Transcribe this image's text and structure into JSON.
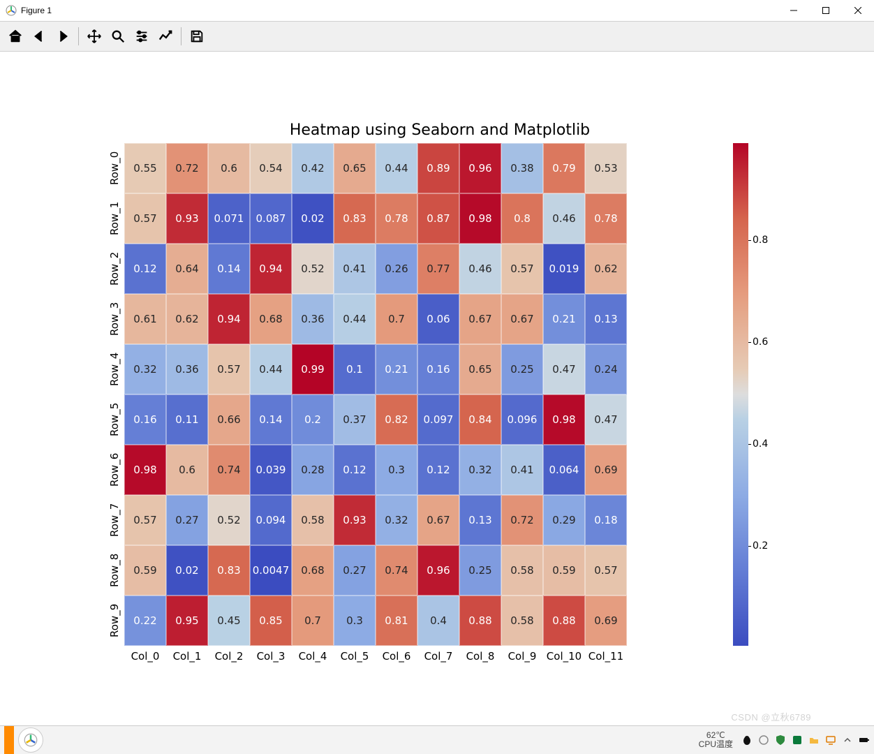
{
  "window": {
    "title": "Figure 1"
  },
  "toolbar": {
    "home": "Home",
    "back": "Back",
    "forward": "Forward",
    "pan": "Pan",
    "zoom": "Zoom",
    "configure": "Configure subplots",
    "edit": "Edit axis",
    "save": "Save"
  },
  "taskbar": {
    "temp_value": "62℃",
    "temp_label": "CPU温度",
    "watermark": "CSDN @立秋6789"
  },
  "chart_data": {
    "type": "heatmap",
    "title": "Heatmap using Seaborn and Matplotlib",
    "xlabel": "",
    "ylabel": "",
    "x_categories": [
      "Col_0",
      "Col_1",
      "Col_2",
      "Col_3",
      "Col_4",
      "Col_5",
      "Col_6",
      "Col_7",
      "Col_8",
      "Col_9",
      "Col_10",
      "Col_11"
    ],
    "y_categories": [
      "Row_0",
      "Row_1",
      "Row_2",
      "Row_3",
      "Row_4",
      "Row_5",
      "Row_6",
      "Row_7",
      "Row_8",
      "Row_9"
    ],
    "values": [
      [
        0.55,
        0.72,
        0.6,
        0.54,
        0.42,
        0.65,
        0.44,
        0.89,
        0.96,
        0.38,
        0.79,
        0.53
      ],
      [
        0.57,
        0.93,
        0.071,
        0.087,
        0.02,
        0.83,
        0.78,
        0.87,
        0.98,
        0.8,
        0.46,
        0.78
      ],
      [
        0.12,
        0.64,
        0.14,
        0.94,
        0.52,
        0.41,
        0.26,
        0.77,
        0.46,
        0.57,
        0.019,
        0.62
      ],
      [
        0.61,
        0.62,
        0.94,
        0.68,
        0.36,
        0.44,
        0.7,
        0.06,
        0.67,
        0.67,
        0.21,
        0.13
      ],
      [
        0.32,
        0.36,
        0.57,
        0.44,
        0.99,
        0.1,
        0.21,
        0.16,
        0.65,
        0.25,
        0.47,
        0.24
      ],
      [
        0.16,
        0.11,
        0.66,
        0.14,
        0.2,
        0.37,
        0.82,
        0.097,
        0.84,
        0.096,
        0.98,
        0.47
      ],
      [
        0.98,
        0.6,
        0.74,
        0.039,
        0.28,
        0.12,
        0.3,
        0.12,
        0.32,
        0.41,
        0.064,
        0.69
      ],
      [
        0.57,
        0.27,
        0.52,
        0.094,
        0.58,
        0.93,
        0.32,
        0.67,
        0.13,
        0.72,
        0.29,
        0.18
      ],
      [
        0.59,
        0.02,
        0.83,
        0.0047,
        0.68,
        0.27,
        0.74,
        0.96,
        0.25,
        0.58,
        0.59,
        0.57
      ],
      [
        0.22,
        0.95,
        0.45,
        0.85,
        0.7,
        0.3,
        0.81,
        0.4,
        0.88,
        0.58,
        0.88,
        0.69
      ]
    ],
    "value_labels": [
      [
        "0.55",
        "0.72",
        "0.6",
        "0.54",
        "0.42",
        "0.65",
        "0.44",
        "0.89",
        "0.96",
        "0.38",
        "0.79",
        "0.53"
      ],
      [
        "0.57",
        "0.93",
        "0.071",
        "0.087",
        "0.02",
        "0.83",
        "0.78",
        "0.87",
        "0.98",
        "0.8",
        "0.46",
        "0.78"
      ],
      [
        "0.12",
        "0.64",
        "0.14",
        "0.94",
        "0.52",
        "0.41",
        "0.26",
        "0.77",
        "0.46",
        "0.57",
        "0.019",
        "0.62"
      ],
      [
        "0.61",
        "0.62",
        "0.94",
        "0.68",
        "0.36",
        "0.44",
        "0.7",
        "0.06",
        "0.67",
        "0.67",
        "0.21",
        "0.13"
      ],
      [
        "0.32",
        "0.36",
        "0.57",
        "0.44",
        "0.99",
        "0.1",
        "0.21",
        "0.16",
        "0.65",
        "0.25",
        "0.47",
        "0.24"
      ],
      [
        "0.16",
        "0.11",
        "0.66",
        "0.14",
        "0.2",
        "0.37",
        "0.82",
        "0.097",
        "0.84",
        "0.096",
        "0.98",
        "0.47"
      ],
      [
        "0.98",
        "0.6",
        "0.74",
        "0.039",
        "0.28",
        "0.12",
        "0.3",
        "0.12",
        "0.32",
        "0.41",
        "0.064",
        "0.69"
      ],
      [
        "0.57",
        "0.27",
        "0.52",
        "0.094",
        "0.58",
        "0.93",
        "0.32",
        "0.67",
        "0.13",
        "0.72",
        "0.29",
        "0.18"
      ],
      [
        "0.59",
        "0.02",
        "0.83",
        "0.0047",
        "0.68",
        "0.27",
        "0.74",
        "0.96",
        "0.25",
        "0.58",
        "0.59",
        "0.57"
      ],
      [
        "0.22",
        "0.95",
        "0.45",
        "0.85",
        "0.7",
        "0.3",
        "0.81",
        "0.4",
        "0.88",
        "0.58",
        "0.88",
        "0.69"
      ]
    ],
    "colorbar": {
      "ticks": [
        0.2,
        0.4,
        0.6,
        0.8
      ],
      "tick_labels": [
        "0.2",
        "0.4",
        "0.6",
        "0.8"
      ],
      "vmin": 0.0047,
      "vmax": 0.99
    },
    "colormap": "coolwarm"
  }
}
